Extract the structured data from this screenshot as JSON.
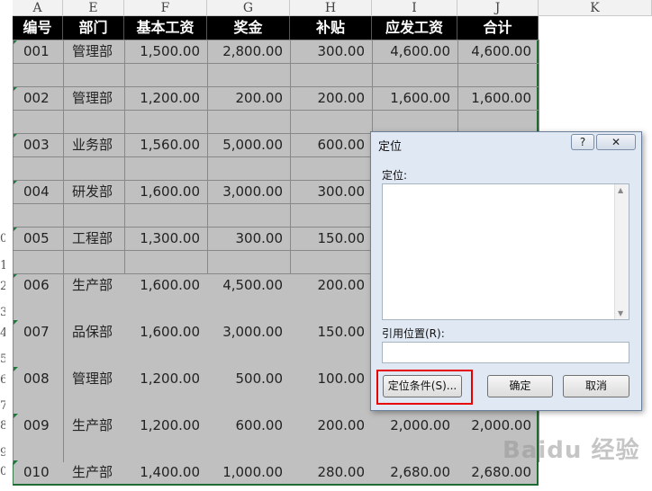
{
  "columns": [
    "A",
    "E",
    "F",
    "G",
    "H",
    "I",
    "J",
    "K"
  ],
  "row_numbers": [
    "0",
    "1",
    "2",
    "3",
    "4",
    "5",
    "6",
    "7",
    "8",
    "9",
    "0"
  ],
  "header": [
    "编号",
    "部门",
    "基本工资",
    "奖金",
    "补贴",
    "应发工资",
    "合计"
  ],
  "rows": [
    [
      "001",
      "管理部",
      "1,500.00",
      "2,800.00",
      "300.00",
      "4,600.00",
      "4,600.00"
    ],
    [
      "002",
      "管理部",
      "1,200.00",
      "200.00",
      "200.00",
      "1,600.00",
      "1,600.00"
    ],
    [
      "003",
      "业务部",
      "1,560.00",
      "5,000.00",
      "600.00",
      "",
      ""
    ],
    [
      "004",
      "研发部",
      "1,600.00",
      "3,000.00",
      "300.00",
      "",
      ""
    ],
    [
      "005",
      "工程部",
      "1,300.00",
      "300.00",
      "150.00",
      "",
      ""
    ],
    [
      "006",
      "生产部",
      "1,600.00",
      "4,500.00",
      "200.00",
      "",
      ""
    ],
    [
      "007",
      "品保部",
      "1,600.00",
      "3,000.00",
      "150.00",
      "",
      ""
    ],
    [
      "008",
      "管理部",
      "1,200.00",
      "500.00",
      "100.00",
      "",
      ""
    ],
    [
      "009",
      "生产部",
      "1,200.00",
      "600.00",
      "200.00",
      "2,000.00",
      "2,000.00"
    ],
    [
      "010",
      "生产部",
      "1,400.00",
      "1,000.00",
      "280.00",
      "2,680.00",
      "2,680.00"
    ]
  ],
  "dialog": {
    "title": "定位",
    "help": "?",
    "close": "✕",
    "goto_label": "定位:",
    "reference_label": "引用位置(R):",
    "reference_value": "",
    "special_button": "定位条件(S)...",
    "ok_button": "确定",
    "cancel_button": "取消"
  },
  "watermark": "Baidu 经验",
  "colors": {
    "selection": "#c0c0c0",
    "header_bg": "#000000",
    "highlight": "#e60000"
  }
}
